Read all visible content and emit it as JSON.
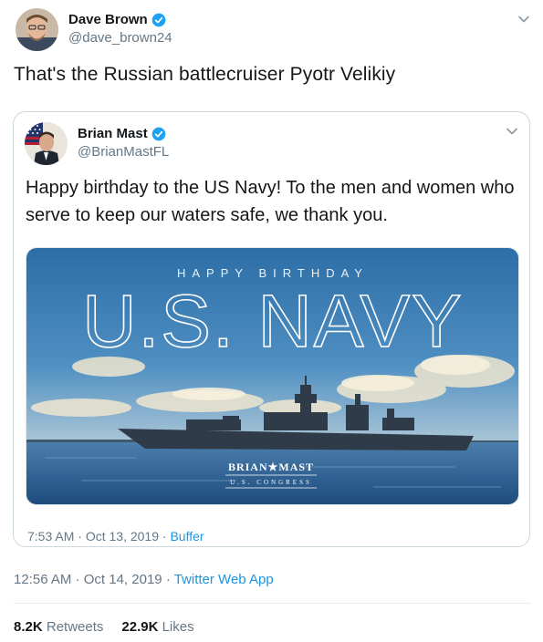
{
  "tweet": {
    "author_name": "Dave Brown",
    "author_handle": "@dave_brown24",
    "text": "That's the Russian battlecruiser Pyotr Velikiy",
    "time": "12:56 AM",
    "date": "Oct 14, 2019",
    "source": "Twitter Web App",
    "separator": "·",
    "retweets_count": "8.2K",
    "retweets_label": "Retweets",
    "likes_count": "22.9K",
    "likes_label": "Likes"
  },
  "quoted": {
    "author_name": "Brian Mast",
    "author_handle": "@BrianMastFL",
    "text": "Happy birthday to the US Navy! To the men and women who serve to keep our waters safe, we thank you.",
    "time": "7:53 AM",
    "date": "Oct 13, 2019",
    "source": "Buffer",
    "separator": "·",
    "image": {
      "overline": "HAPPY BIRTHDAY",
      "headline": "U.S. NAVY",
      "logo_name": "BRIAN★MAST",
      "logo_sub": "U.S. CONGRESS"
    }
  },
  "colors": {
    "verified": "#1da1f2",
    "link": "#1b95e0",
    "muted": "#657786",
    "border": "#ccd6dd"
  },
  "icons": {
    "verified": "verified-badge-icon",
    "caret": "chevron-down-icon"
  }
}
